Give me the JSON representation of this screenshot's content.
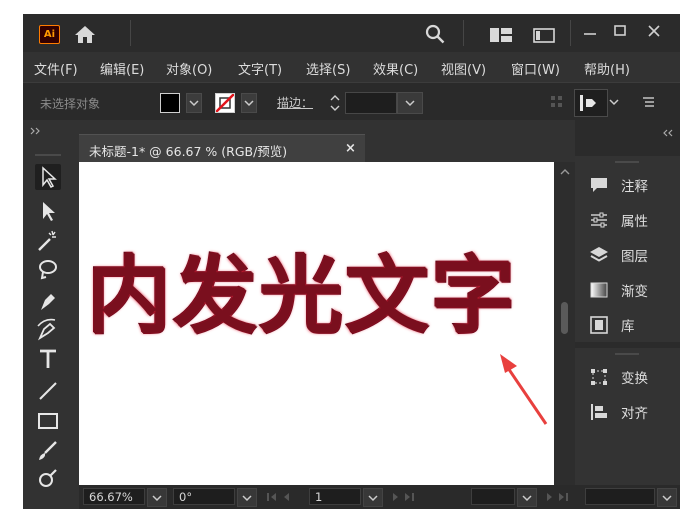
{
  "titlebar": {
    "logo_text": "Ai",
    "icons": [
      "home-icon",
      "search-icon",
      "arrange-documents-icon",
      "panel-layout-icon",
      "minimize-icon",
      "maximize-icon",
      "close-icon"
    ]
  },
  "menu": {
    "items": [
      "文件(F)",
      "编辑(E)",
      "对象(O)",
      "文字(T)",
      "选择(S)",
      "效果(C)",
      "视图(V)",
      "窗口(W)",
      "帮助(H)"
    ]
  },
  "controlbar": {
    "selection_status": "未选择对象",
    "stroke_label": "描边：",
    "stroke_value": ""
  },
  "document": {
    "tab_label": "未标题-1* @ 66.67 % (RGB/预览)",
    "tab_close": "×",
    "artwork_text": "内发光文字",
    "colors": {
      "text_fill": "#7a0f1e",
      "inner_glow": "#e1223a",
      "annotation_arrow": "#e8403e"
    }
  },
  "tools": [
    "selection-tool",
    "direct-selection-tool",
    "magic-wand-tool",
    "lasso-tool",
    "pen-tool",
    "curvature-tool",
    "type-tool",
    "line-tool",
    "rectangle-tool",
    "paintbrush-tool",
    "shaper-tool"
  ],
  "panels": {
    "group1": [
      "注释",
      "属性",
      "图层",
      "渐变",
      "库"
    ],
    "group2": [
      "变换",
      "对齐"
    ]
  },
  "statusbar": {
    "zoom": "66.67%",
    "rotate": "0°",
    "artboard": "1"
  }
}
